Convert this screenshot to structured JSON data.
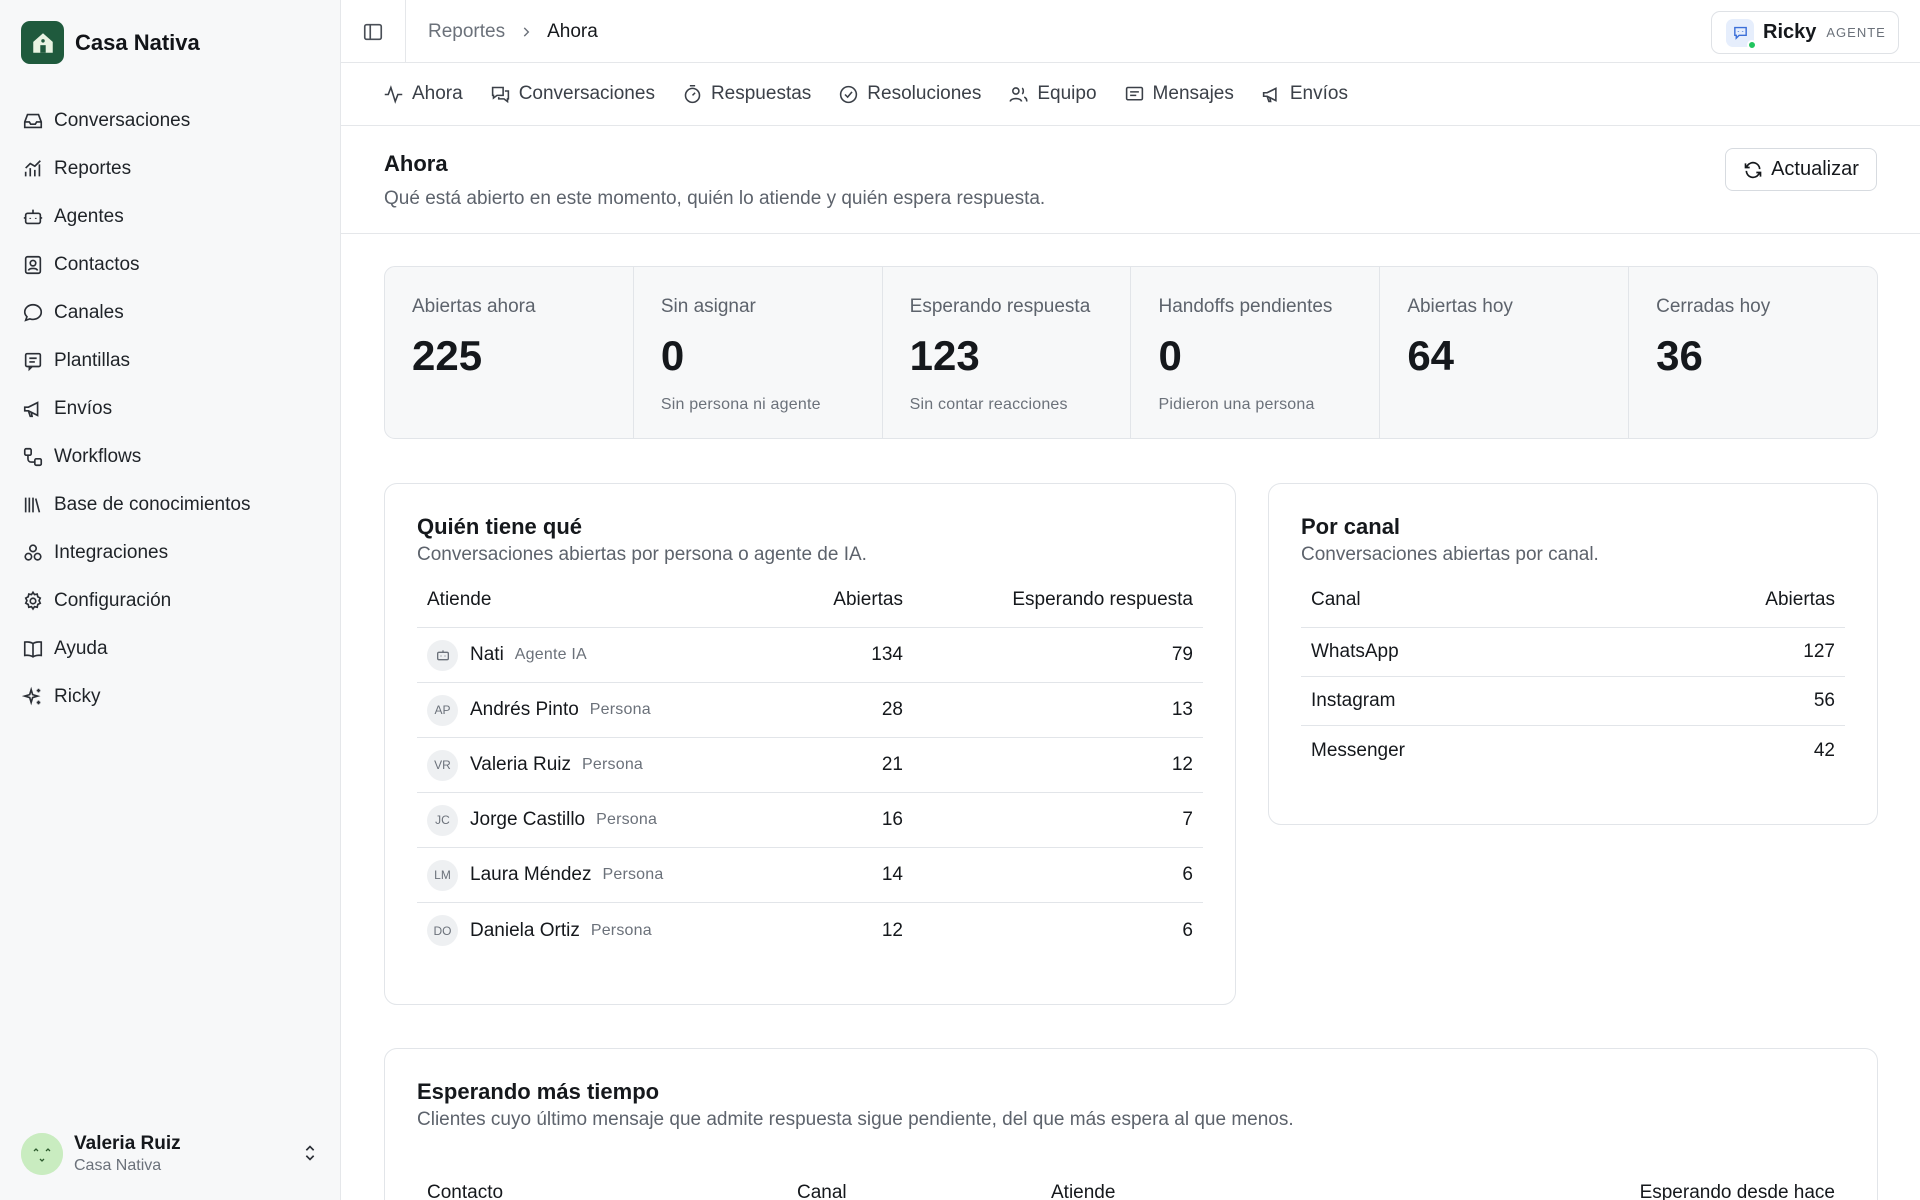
{
  "brand": {
    "name": "Casa Nativa",
    "logo_icon": "house-icon",
    "accent": "#1f5a3d"
  },
  "sidebar": {
    "items": [
      {
        "label": "Conversaciones",
        "icon": "inbox-icon"
      },
      {
        "label": "Reportes",
        "icon": "chart-icon"
      },
      {
        "label": "Agentes",
        "icon": "bot-icon"
      },
      {
        "label": "Contactos",
        "icon": "contact-icon"
      },
      {
        "label": "Canales",
        "icon": "chat-bubble-icon"
      },
      {
        "label": "Plantillas",
        "icon": "template-icon"
      },
      {
        "label": "Envíos",
        "icon": "megaphone-icon"
      },
      {
        "label": "Workflows",
        "icon": "workflow-icon"
      },
      {
        "label": "Base de conocimientos",
        "icon": "library-icon"
      },
      {
        "label": "Integraciones",
        "icon": "integrations-icon"
      },
      {
        "label": "Configuración",
        "icon": "gear-icon"
      },
      {
        "label": "Ayuda",
        "icon": "book-icon"
      },
      {
        "label": "Ricky",
        "icon": "sparkles-icon"
      }
    ],
    "user": {
      "name": "Valeria Ruiz",
      "org": "Casa Nativa",
      "avatar_face": "ˆ ˆ\nv"
    }
  },
  "topbar": {
    "breadcrumb": [
      "Reportes",
      "Ahora"
    ],
    "agent": {
      "name": "Ricky",
      "tag": "AGENTE"
    }
  },
  "tabs": [
    {
      "label": "Ahora",
      "icon": "activity-icon"
    },
    {
      "label": "Conversaciones",
      "icon": "messages-icon"
    },
    {
      "label": "Respuestas",
      "icon": "timer-icon"
    },
    {
      "label": "Resoluciones",
      "icon": "check-circle-icon"
    },
    {
      "label": "Equipo",
      "icon": "users-icon"
    },
    {
      "label": "Mensajes",
      "icon": "message-square-icon"
    },
    {
      "label": "Envíos",
      "icon": "megaphone-icon"
    }
  ],
  "page": {
    "title": "Ahora",
    "subtitle": "Qué está abierto en este momento, quién lo atiende y quién espera respuesta.",
    "refresh_label": "Actualizar"
  },
  "stats": [
    {
      "label": "Abiertas ahora",
      "value": "225",
      "note": ""
    },
    {
      "label": "Sin asignar",
      "value": "0",
      "note": "Sin persona ni agente"
    },
    {
      "label": "Esperando respuesta",
      "value": "123",
      "note": "Sin contar reacciones"
    },
    {
      "label": "Handoffs pendientes",
      "value": "0",
      "note": "Pidieron una persona"
    },
    {
      "label": "Abiertas hoy",
      "value": "64",
      "note": ""
    },
    {
      "label": "Cerradas hoy",
      "value": "36",
      "note": ""
    }
  ],
  "who": {
    "title": "Quién tiene qué",
    "subtitle": "Conversaciones abiertas por persona o agente de IA.",
    "headers": [
      "Atiende",
      "Abiertas",
      "Esperando respuesta"
    ],
    "rows": [
      {
        "avatar": "",
        "name": "Nati",
        "kind": "Agente IA",
        "open": "134",
        "waiting": "79"
      },
      {
        "avatar": "AP",
        "name": "Andrés Pinto",
        "kind": "Persona",
        "open": "28",
        "waiting": "13"
      },
      {
        "avatar": "VR",
        "name": "Valeria Ruiz",
        "kind": "Persona",
        "open": "21",
        "waiting": "12"
      },
      {
        "avatar": "JC",
        "name": "Jorge Castillo",
        "kind": "Persona",
        "open": "16",
        "waiting": "7"
      },
      {
        "avatar": "LM",
        "name": "Laura Méndez",
        "kind": "Persona",
        "open": "14",
        "waiting": "6"
      },
      {
        "avatar": "DO",
        "name": "Daniela Ortiz",
        "kind": "Persona",
        "open": "12",
        "waiting": "6"
      }
    ]
  },
  "channels": {
    "title": "Por canal",
    "subtitle": "Conversaciones abiertas por canal.",
    "headers": [
      "Canal",
      "Abiertas"
    ],
    "rows": [
      {
        "name": "WhatsApp",
        "open": "127"
      },
      {
        "name": "Instagram",
        "open": "56"
      },
      {
        "name": "Messenger",
        "open": "42"
      }
    ]
  },
  "waiting": {
    "title": "Esperando más tiempo",
    "subtitle": "Clientes cuyo último mensaje que admite respuesta sigue pendiente, del que más espera al que menos.",
    "headers": [
      "Contacto",
      "Canal",
      "Atiende",
      "Esperando desde hace"
    ]
  }
}
